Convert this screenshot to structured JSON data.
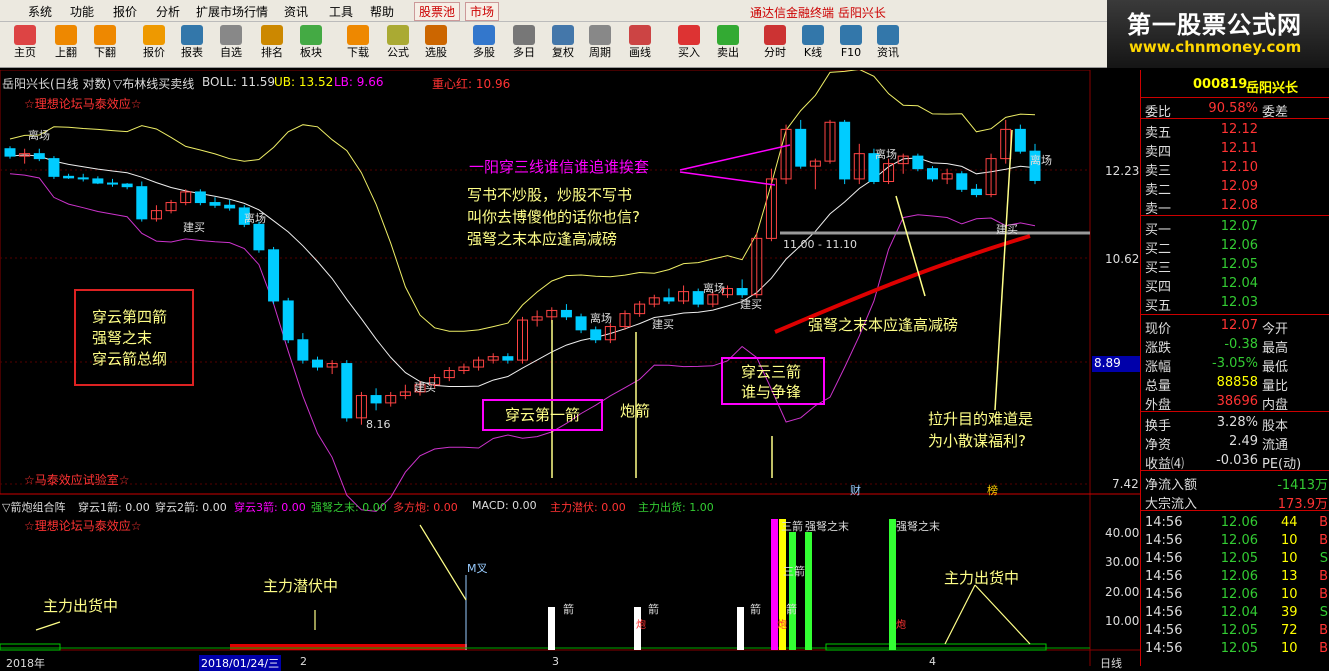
{
  "menu": {
    "items": [
      "系统",
      "功能",
      "报价",
      "分析",
      "扩展市场行情",
      "资讯",
      "工具",
      "帮助"
    ],
    "tabs": [
      "股票池",
      "市场"
    ],
    "title": "通达信金融终端 岳阳兴长"
  },
  "logo": {
    "cn": "第一股票公式网",
    "url": "www.chnmoney.com"
  },
  "toolbar": [
    {
      "label": "主页",
      "icon": "home-icon",
      "color": "#d44"
    },
    {
      "label": "上翻",
      "icon": "arrow-up-icon",
      "color": "#e80"
    },
    {
      "label": "下翻",
      "icon": "arrow-down-icon",
      "color": "#e80"
    },
    {
      "label": "报价",
      "icon": "quote-icon",
      "color": "#e90"
    },
    {
      "label": "报表",
      "icon": "report-icon",
      "color": "#37a"
    },
    {
      "label": "自选",
      "icon": "f6-icon",
      "color": "#888"
    },
    {
      "label": "排名",
      "icon": "rank-icon",
      "color": "#c80"
    },
    {
      "label": "板块",
      "icon": "sector-icon",
      "color": "#4a4"
    },
    {
      "label": "下载",
      "icon": "download-icon",
      "color": "#e80"
    },
    {
      "label": "公式",
      "icon": "formula-icon",
      "color": "#aa3"
    },
    {
      "label": "选股",
      "icon": "stock-pick-icon",
      "color": "#c60"
    },
    {
      "label": "多股",
      "icon": "multi-stock-icon",
      "color": "#37c"
    },
    {
      "label": "多日",
      "icon": "multi-day-icon",
      "color": "#777"
    },
    {
      "label": "复权",
      "icon": "adjust-icon",
      "color": "#47a"
    },
    {
      "label": "周期",
      "icon": "f8-icon",
      "color": "#888"
    },
    {
      "label": "画线",
      "icon": "draw-icon",
      "color": "#c44"
    },
    {
      "label": "买入",
      "icon": "buy-icon",
      "color": "#d33"
    },
    {
      "label": "卖出",
      "icon": "sell-icon",
      "color": "#3a3"
    },
    {
      "label": "分时",
      "icon": "timeshare-icon",
      "color": "#c33"
    },
    {
      "label": "K线",
      "icon": "kline-icon",
      "color": "#37a"
    },
    {
      "label": "F10",
      "icon": "f10-icon",
      "color": "#37a"
    },
    {
      "label": "资讯",
      "icon": "news-icon",
      "color": "#37a"
    }
  ],
  "chart": {
    "header_name": "岳阳兴长(日线 对数)",
    "header_indicator": "▽布林线买卖线",
    "header_boll": "BOLL: 11.59",
    "header_ub": "UB: 13.52",
    "header_lb": "LB: 9.66",
    "header_center": "重心红: 10.96",
    "watermark_top": "☆理想论坛马泰效应☆",
    "watermark_bottom": "☆马泰效应试验室☆",
    "price_ticks": [
      "12.23",
      "10.62",
      "8.89",
      "7.42"
    ],
    "low_label": "8.16",
    "range_label": "11.00 - 11.10",
    "cai_marker": "财",
    "bang_marker": "榜",
    "box_left": [
      "穿云第四箭",
      "强弩之末",
      "穿云箭总纲"
    ],
    "box_first": "穿云第一箭",
    "label_pao": "炮箭",
    "box_third": [
      "穿云三箭",
      "谁与争锋"
    ],
    "text_main_title": "一阳穿三线谁信谁追谁挨套",
    "text_poem": [
      "写书不炒股，炒股不写书",
      "叫你去博傻他的话你也信?",
      "强弩之末本应逢高减磅"
    ],
    "text_red": "强弩之末本应逢高减磅",
    "text_rise": [
      "拉升目的难道是",
      "为小散谋福利?"
    ],
    "k_tags": [
      "离场",
      "建买",
      "离场",
      "建买",
      "离场",
      "建买",
      "离场",
      "建买",
      "离场",
      "建买",
      "离场"
    ]
  },
  "chart_data": {
    "type": "candlestick",
    "title": "岳阳兴长(日线 对数)",
    "y_ticks": [
      12.23,
      10.62,
      8.89,
      7.42
    ],
    "candles": [
      [
        12.7,
        12.75,
        12.5,
        12.55
      ],
      [
        12.55,
        12.7,
        12.4,
        12.6
      ],
      [
        12.6,
        12.7,
        12.45,
        12.5
      ],
      [
        12.5,
        12.55,
        12.1,
        12.15
      ],
      [
        12.15,
        12.2,
        12.1,
        12.12
      ],
      [
        12.12,
        12.2,
        12.05,
        12.1
      ],
      [
        12.1,
        12.15,
        12.0,
        12.02
      ],
      [
        12.02,
        12.1,
        11.95,
        12.0
      ],
      [
        12.0,
        12.02,
        11.9,
        11.95
      ],
      [
        11.95,
        12.05,
        11.3,
        11.35
      ],
      [
        11.35,
        11.6,
        11.3,
        11.5
      ],
      [
        11.5,
        11.7,
        11.45,
        11.65
      ],
      [
        11.65,
        11.9,
        11.6,
        11.85
      ],
      [
        11.85,
        11.9,
        11.6,
        11.65
      ],
      [
        11.65,
        11.75,
        11.55,
        11.6
      ],
      [
        11.6,
        11.7,
        11.5,
        11.55
      ],
      [
        11.55,
        11.6,
        11.2,
        11.25
      ],
      [
        11.25,
        11.3,
        10.75,
        10.8
      ],
      [
        10.8,
        10.85,
        9.9,
        9.95
      ],
      [
        9.95,
        10.0,
        9.3,
        9.35
      ],
      [
        9.35,
        9.45,
        9.0,
        9.05
      ],
      [
        9.05,
        9.1,
        8.9,
        8.95
      ],
      [
        8.95,
        9.05,
        8.85,
        9.0
      ],
      [
        9.0,
        9.05,
        8.2,
        8.25
      ],
      [
        8.25,
        8.6,
        8.16,
        8.55
      ],
      [
        8.55,
        8.65,
        8.35,
        8.45
      ],
      [
        8.45,
        8.6,
        8.4,
        8.55
      ],
      [
        8.55,
        8.7,
        8.5,
        8.6
      ],
      [
        8.6,
        8.75,
        8.55,
        8.7
      ],
      [
        8.7,
        8.85,
        8.65,
        8.8
      ],
      [
        8.8,
        8.95,
        8.75,
        8.9
      ],
      [
        8.9,
        9.0,
        8.85,
        8.95
      ],
      [
        8.95,
        9.1,
        8.9,
        9.05
      ],
      [
        9.05,
        9.15,
        9.0,
        9.1
      ],
      [
        9.1,
        9.15,
        9.0,
        9.05
      ],
      [
        9.05,
        9.7,
        9.0,
        9.65
      ],
      [
        9.65,
        9.8,
        9.55,
        9.7
      ],
      [
        9.7,
        9.85,
        9.6,
        9.8
      ],
      [
        9.8,
        9.9,
        9.65,
        9.7
      ],
      [
        9.7,
        9.75,
        9.45,
        9.5
      ],
      [
        9.5,
        9.55,
        9.3,
        9.35
      ],
      [
        9.35,
        9.6,
        9.3,
        9.55
      ],
      [
        9.55,
        9.8,
        9.5,
        9.75
      ],
      [
        9.75,
        9.95,
        9.7,
        9.9
      ],
      [
        9.9,
        10.05,
        9.85,
        10.0
      ],
      [
        10.0,
        10.15,
        9.9,
        9.95
      ],
      [
        9.95,
        10.2,
        9.9,
        10.1
      ],
      [
        10.1,
        10.15,
        9.85,
        9.9
      ],
      [
        9.9,
        10.1,
        9.85,
        10.05
      ],
      [
        10.05,
        10.2,
        10.0,
        10.15
      ],
      [
        10.15,
        10.3,
        10.0,
        10.05
      ],
      [
        10.05,
        11.1,
        10.0,
        11.0
      ],
      [
        11.0,
        12.3,
        10.95,
        12.1
      ],
      [
        12.1,
        13.2,
        12.0,
        13.1
      ],
      [
        13.1,
        13.3,
        12.3,
        12.35
      ],
      [
        12.35,
        12.5,
        11.9,
        12.45
      ],
      [
        12.45,
        13.3,
        12.4,
        13.25
      ],
      [
        13.25,
        13.3,
        12.0,
        12.1
      ],
      [
        12.1,
        12.8,
        12.0,
        12.6
      ],
      [
        12.6,
        12.7,
        12.0,
        12.05
      ],
      [
        12.05,
        12.5,
        12.0,
        12.4
      ],
      [
        12.4,
        12.6,
        12.2,
        12.55
      ],
      [
        12.55,
        12.6,
        12.25,
        12.3
      ],
      [
        12.3,
        12.35,
        12.05,
        12.1
      ],
      [
        12.1,
        12.3,
        12.0,
        12.2
      ],
      [
        12.2,
        12.25,
        11.85,
        11.9
      ],
      [
        11.9,
        12.0,
        11.75,
        11.8
      ],
      [
        11.8,
        12.6,
        11.75,
        12.5
      ],
      [
        12.5,
        13.3,
        12.4,
        13.1
      ],
      [
        13.1,
        13.2,
        12.6,
        12.65
      ],
      [
        12.65,
        12.8,
        12.0,
        12.07
      ]
    ],
    "boll": {
      "mid": 11.59,
      "upper": 13.52,
      "lower": 9.66
    },
    "center_red": 10.96,
    "indicator_panel": {
      "name": "▽箭炮组合阵",
      "values": [
        {
          "name": "穿云1箭",
          "value": "0.00"
        },
        {
          "name": "穿云2箭",
          "value": "0.00"
        },
        {
          "name": "穿云3箭",
          "value": "0.00"
        },
        {
          "name": "强弩之末",
          "value": "0.00"
        },
        {
          "name": "多方炮",
          "value": "0.00"
        },
        {
          "name": "MACD",
          "value": "0.00"
        },
        {
          "name": "主力潜伏",
          "value": "0.00"
        },
        {
          "name": "主力出货",
          "value": "1.00"
        }
      ],
      "y_ticks": [
        40.0,
        30.0,
        20.0,
        10.0
      ]
    }
  },
  "indicator": {
    "label_name": "▽箭炮组合阵",
    "l1": "穿云1箭: 0.00",
    "l2": "穿云2箭: 0.00",
    "l3": "穿云3箭: 0.00",
    "l4": "强弩之末: 0.00",
    "l5": "多方炮: 0.00",
    "l6": "MACD: 0.00",
    "l7": "主力潜伏: 0.00",
    "l8": "主力出货: 1.00",
    "watermark": "☆理想论坛马泰效应☆",
    "ticks": [
      "40.00",
      "30.00",
      "20.00",
      "10.00"
    ],
    "txt_out_left": "主力出货中",
    "txt_lurk": "主力潜伏中",
    "txt_out_right": "主力出货中",
    "m_cross": "M叉",
    "arrow_tag": "箭",
    "pao_tag": "炮",
    "san_tag": "三箭",
    "qiangnu_tag": "强弩之末",
    "date_2018": "2018年",
    "date_sel": "2018/01/24/三",
    "m2": "2",
    "m3": "3",
    "m4": "4",
    "period": "日线"
  },
  "quote": {
    "code": "000819",
    "name": "岳阳兴长",
    "weibi_label": "委比",
    "weibi_value": "90.58%",
    "weicha_label": "委差",
    "asks": [
      {
        "label": "卖五",
        "price": "12.12"
      },
      {
        "label": "卖四",
        "price": "12.11"
      },
      {
        "label": "卖三",
        "price": "12.10"
      },
      {
        "label": "卖二",
        "price": "12.09"
      },
      {
        "label": "卖一",
        "price": "12.08"
      }
    ],
    "bids": [
      {
        "label": "买一",
        "price": "12.07"
      },
      {
        "label": "买二",
        "price": "12.06"
      },
      {
        "label": "买三",
        "price": "12.05"
      },
      {
        "label": "买四",
        "price": "12.04"
      },
      {
        "label": "买五",
        "price": "12.03"
      }
    ],
    "stats": [
      {
        "l1": "现价",
        "v1": "12.07",
        "l2": "今开",
        "color": "#f33"
      },
      {
        "l1": "涨跌",
        "v1": "-0.38",
        "l2": "最高",
        "color": "#3c3"
      },
      {
        "l1": "涨幅",
        "v1": "-3.05%",
        "l2": "最低",
        "color": "#3c3"
      },
      {
        "l1": "总量",
        "v1": "88858",
        "l2": "量比",
        "color": "#ff0"
      },
      {
        "l1": "外盘",
        "v1": "38696",
        "l2": "内盘",
        "color": "#f33"
      }
    ],
    "fund": [
      {
        "l1": "换手",
        "v1": "3.28%",
        "l2": "股本"
      },
      {
        "l1": "净资",
        "v1": "2.49",
        "l2": "流通"
      },
      {
        "l1": "收益⑷",
        "v1": "-0.036",
        "l2": "PE(动)"
      }
    ],
    "flow": [
      {
        "label": "净流入额",
        "value": "-1413万"
      },
      {
        "label": "大宗流入",
        "value": "173.9万"
      }
    ],
    "ticks": [
      {
        "t": "14:56",
        "p": "12.06",
        "v": "44",
        "d": "B"
      },
      {
        "t": "14:56",
        "p": "12.06",
        "v": "10",
        "d": "B"
      },
      {
        "t": "14:56",
        "p": "12.05",
        "v": "10",
        "d": "S"
      },
      {
        "t": "14:56",
        "p": "12.06",
        "v": "13",
        "d": "B"
      },
      {
        "t": "14:56",
        "p": "12.06",
        "v": "10",
        "d": "B"
      },
      {
        "t": "14:56",
        "p": "12.04",
        "v": "39",
        "d": "S"
      },
      {
        "t": "14:56",
        "p": "12.05",
        "v": "72",
        "d": "B"
      },
      {
        "t": "14:56",
        "p": "12.05",
        "v": "10",
        "d": "B"
      }
    ]
  }
}
